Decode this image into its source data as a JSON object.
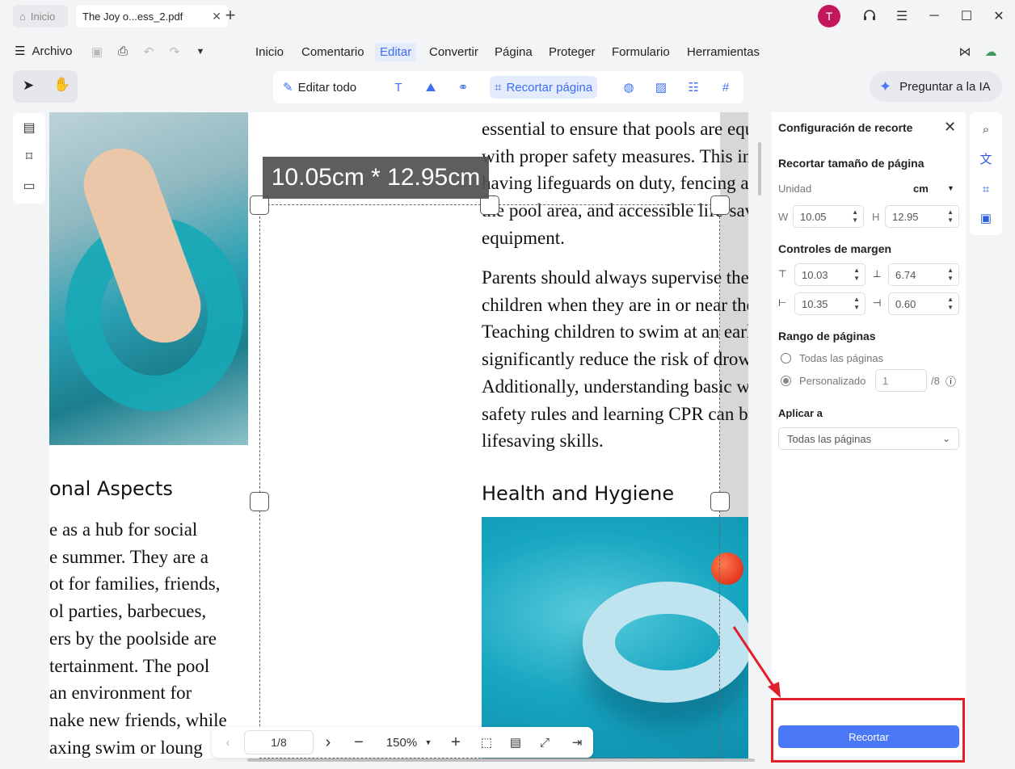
{
  "tabs": {
    "home": "Inicio",
    "doc": "The Joy o...ess_2.pdf"
  },
  "user": {
    "initial": "T"
  },
  "menu": {
    "file": "Archivo",
    "items": [
      "Inicio",
      "Comentario",
      "Editar",
      "Convertir",
      "Página",
      "Proteger",
      "Formulario",
      "Herramientas"
    ],
    "active": "Editar"
  },
  "ribbon": {
    "edit_all": "Editar todo",
    "crop_page": "Recortar página"
  },
  "ai": {
    "label": "Preguntar a la IA"
  },
  "document": {
    "left_heading": "onal Aspects",
    "left_lines": [
      "e as a hub for social",
      "e summer. They are a",
      "ot for families, friends,",
      "ol parties, barbecues,",
      "ers by the poolside are",
      "tertainment. The pool",
      "an environment for",
      "nake new friends, while",
      "axing swim or loung"
    ],
    "para1": [
      "essential to ensure that pools are equipped",
      "with proper safety measures. This includes",
      "having lifeguards on duty, fencing around",
      "the pool area, and accessible life-saving",
      "equipment."
    ],
    "para2": [
      "Parents should always supervise their",
      "children when they are in or near the water.",
      "Teaching children to swim at an early age can",
      "significantly reduce the risk of drowning.",
      "Additionally, understanding basic water",
      "safety rules and learning CPR can be",
      "lifesaving skills."
    ],
    "heading2": "Health and Hygiene",
    "crop_size": "10.05cm * 12.95cm"
  },
  "pagebar": {
    "page": "1/8",
    "zoom": "150%"
  },
  "panel": {
    "title": "Configuración de recorte",
    "size_section": "Recortar tamaño de página",
    "unit_label": "Unidad",
    "unit_value": "cm",
    "w_label": "W",
    "w_value": "10.05",
    "h_label": "H",
    "h_value": "12.95",
    "margin_section": "Controles de margen",
    "m_top": "10.03",
    "m_bottom": "6.74",
    "m_left": "10.35",
    "m_right": "0.60",
    "range_section": "Rango de páginas",
    "all_pages": "Todas las páginas",
    "custom": "Personalizado",
    "custom_value": "1",
    "of_total": "/8",
    "apply_section": "Aplicar a",
    "apply_value": "Todas las páginas",
    "apply_button": "Recortar"
  },
  "colors": {
    "accent": "#3d6ef5",
    "button": "#4a78f6",
    "highlight": "#e0202a",
    "avatar": "#c2185b"
  }
}
